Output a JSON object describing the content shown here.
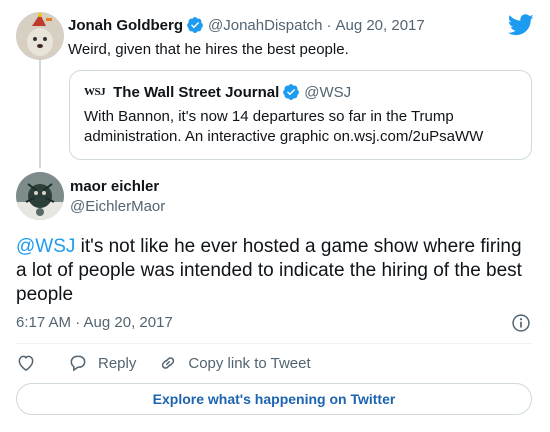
{
  "parent_tweet": {
    "author_name": "Jonah Goldberg",
    "handle": "@JonahDispatch",
    "separator": "·",
    "date": "Aug 20, 2017",
    "text": "Weird, given that he hires the best people."
  },
  "quoted_tweet": {
    "logo_text": "WSJ",
    "author_name": "The Wall Street Journal",
    "handle": "@WSJ",
    "text": "With Bannon, it's now 14 departures so far in the Trump administration. An interactive graphic on.wsj.com/2uPsaWW"
  },
  "main_tweet": {
    "author_name": "maor eichler",
    "handle": "@EichlerMaor",
    "mention": "@WSJ",
    "text": " it's not like he ever hosted a game show where firing a lot of people was intended to indicate the hiring of the best people",
    "timestamp": "6:17 AM · Aug 20, 2017"
  },
  "actions": {
    "reply_label": "Reply",
    "copy_link_label": "Copy link to Tweet"
  },
  "explore_label": "Explore what's happening on Twitter",
  "colors": {
    "accent": "#1d9bf0",
    "text": "#0f1419",
    "muted": "#536471",
    "border": "#cfd9de"
  },
  "icons": [
    "twitter-bird-icon",
    "verified-badge-icon",
    "info-icon",
    "heart-icon",
    "reply-icon",
    "link-icon"
  ]
}
